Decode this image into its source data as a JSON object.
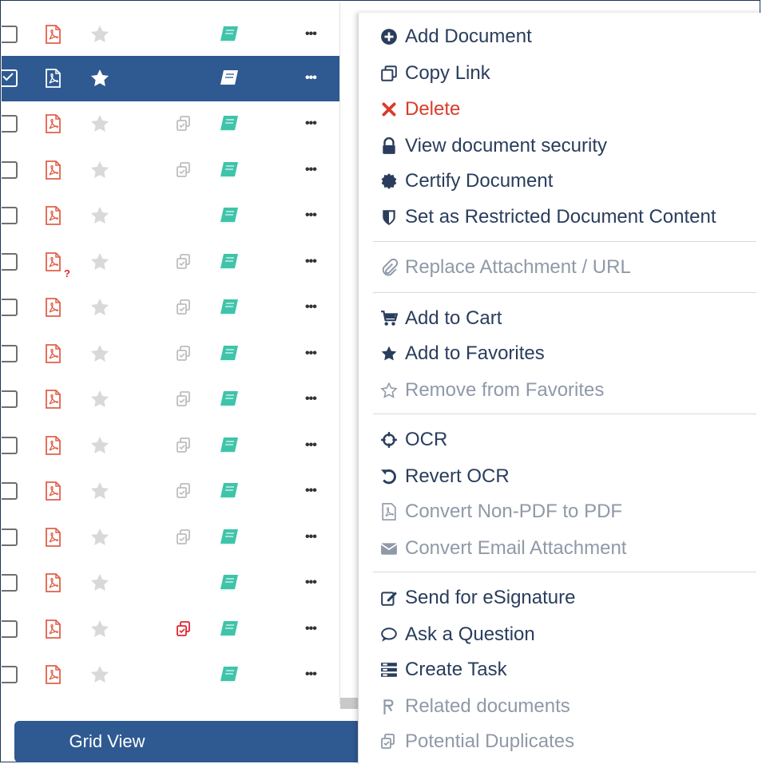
{
  "list": {
    "rows": [
      {
        "selected": false,
        "dup": false,
        "dup_red": false,
        "question": false
      },
      {
        "selected": true,
        "dup": false,
        "dup_red": false,
        "question": false
      },
      {
        "selected": false,
        "dup": true,
        "dup_red": false,
        "question": false
      },
      {
        "selected": false,
        "dup": true,
        "dup_red": false,
        "question": false
      },
      {
        "selected": false,
        "dup": false,
        "dup_red": false,
        "question": false
      },
      {
        "selected": false,
        "dup": true,
        "dup_red": false,
        "question": true
      },
      {
        "selected": false,
        "dup": true,
        "dup_red": false,
        "question": false
      },
      {
        "selected": false,
        "dup": true,
        "dup_red": false,
        "question": false
      },
      {
        "selected": false,
        "dup": true,
        "dup_red": false,
        "question": false
      },
      {
        "selected": false,
        "dup": true,
        "dup_red": false,
        "question": false
      },
      {
        "selected": false,
        "dup": true,
        "dup_red": false,
        "question": false
      },
      {
        "selected": false,
        "dup": true,
        "dup_red": false,
        "question": false
      },
      {
        "selected": false,
        "dup": false,
        "dup_red": false,
        "question": false
      },
      {
        "selected": false,
        "dup": true,
        "dup_red": true,
        "question": false
      },
      {
        "selected": false,
        "dup": false,
        "dup_red": false,
        "question": false
      }
    ],
    "more_label": "•••",
    "question_mark": "?"
  },
  "grid_view_label": "Grid View",
  "menu": {
    "items": [
      {
        "label": "Add Document",
        "icon": "plus-circle-icon",
        "style": "normal"
      },
      {
        "label": "Copy Link",
        "icon": "copy-icon",
        "style": "normal"
      },
      {
        "label": "Delete",
        "icon": "x-icon",
        "style": "danger"
      },
      {
        "label": "View document security",
        "icon": "lock-icon",
        "style": "normal"
      },
      {
        "label": "Certify Document",
        "icon": "certificate-icon",
        "style": "normal"
      },
      {
        "label": "Set as Restricted Document Content",
        "icon": "shield-icon",
        "style": "normal"
      },
      {
        "label": "Replace Attachment / URL",
        "icon": "paperclip-icon",
        "style": "disabled"
      },
      {
        "label": "Add to Cart",
        "icon": "cart-icon",
        "style": "normal"
      },
      {
        "label": "Add to Favorites",
        "icon": "star-icon",
        "style": "normal"
      },
      {
        "label": "Remove from Favorites",
        "icon": "star-outline-icon",
        "style": "disabled"
      },
      {
        "label": "OCR",
        "icon": "crosshair-icon",
        "style": "normal"
      },
      {
        "label": "Revert OCR",
        "icon": "undo-icon",
        "style": "normal"
      },
      {
        "label": "Convert Non-PDF to PDF",
        "icon": "pdf-icon",
        "style": "disabled"
      },
      {
        "label": "Convert Email Attachment",
        "icon": "envelope-icon",
        "style": "disabled"
      },
      {
        "label": "Send for eSignature",
        "icon": "edit-icon",
        "style": "normal"
      },
      {
        "label": "Ask a Question",
        "icon": "comment-icon",
        "style": "normal"
      },
      {
        "label": "Create Task",
        "icon": "tasks-icon",
        "style": "normal"
      },
      {
        "label": "Related documents",
        "icon": "related-icon",
        "style": "disabled"
      },
      {
        "label": "Potential Duplicates",
        "icon": "duplicate-icon",
        "style": "disabled"
      }
    ]
  },
  "colors": {
    "accent": "#2f5a91",
    "pdf_red": "#e0604a",
    "danger": "#d93b2a",
    "book_teal": "#3fc4aa",
    "star_gray": "#d9d9d9",
    "text_dark": "#2a3d5c",
    "text_disabled": "#8f99a8"
  }
}
